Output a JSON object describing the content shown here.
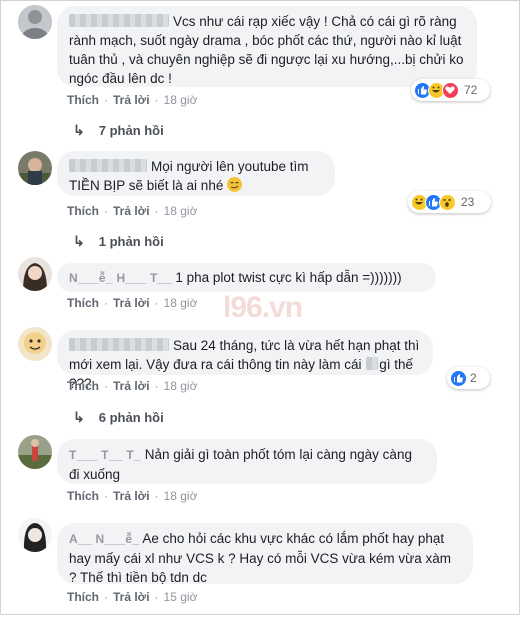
{
  "common": {
    "like": "Thích",
    "reply": "Trả lời",
    "dot": "·"
  },
  "comments": [
    {
      "text": "Vcs như cái rạp xiếc vậy ! Chả có cái gì rõ ràng rành mạch, suốt ngày drama , bóc phốt các thứ, người nào kỉ luật tuân thủ , và chuyên nghiệp sẽ đi ngược lại xu hướng,...bị chửi ko ngóc đầu lên dc !",
      "time": "18 giờ",
      "reaction_count": "72",
      "replies": "7 phản hồi"
    },
    {
      "text": "Mọi người lên youtube tìm TIỀN BỊP sẽ biết là ai nhé",
      "time": "18 giờ",
      "reaction_count": "23",
      "replies": "1 phản hồi"
    },
    {
      "author_partial": "N___ễ_ H___ T__",
      "text": "1 pha plot twist cực kì hấp dẫn =)))))))",
      "time": "18 giờ"
    },
    {
      "text": "Sau 24 tháng, tức là vừa hết hạn phạt thì mới xem lại. Vậy đưa ra cái thông tin này làm cái",
      "text_tail": "gì thế ???",
      "time": "18 giờ",
      "reaction_count": "2",
      "replies": "6 phản hồi"
    },
    {
      "author_partial": "T___ T__ T_",
      "text": "Nản giải gì toàn phốt tóm lại càng ngày càng đi xuống",
      "time": "18 giờ"
    },
    {
      "author_partial": "A__ N___ễ_",
      "text": "Ae cho hỏi các khu vực khác có lắm phốt hay phạt hay mấy cái xl như VCS k ? Hay có mỗi VCS vừa kém vừa xàm ? Thế thì tiền bộ tdn dc",
      "time": "15 giờ"
    }
  ],
  "watermark": "l96.vn",
  "colors": {
    "like": "#2078f4",
    "love": "#f33e58",
    "haha": "#f7c928",
    "bubble": "#f2f3f5"
  }
}
